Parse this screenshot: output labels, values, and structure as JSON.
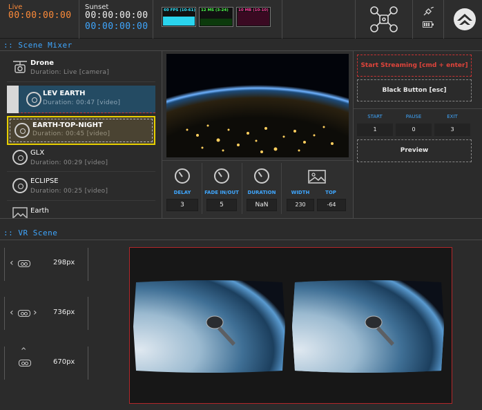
{
  "header": {
    "live_label": "Live",
    "live_time": "00:00:00:00",
    "sunset_label": "Sunset",
    "sunset_time_1": "00:00:00:00",
    "sunset_time_2": "00:00:00:00",
    "stats": [
      {
        "label": "60 FPS (10-61)",
        "color": "#33e6ff"
      },
      {
        "label": "12 MS (3-24)",
        "color": "#4dff4d"
      },
      {
        "label": "10 MB (10-10)",
        "color": "#ff3d9e"
      }
    ]
  },
  "scene_mixer": {
    "title": ":: Scene Mixer",
    "scenes": [
      {
        "name": "Drone",
        "duration": "Duration: Live [camera]",
        "icon": "camera-icon"
      },
      {
        "name": "LEV EARTH",
        "duration": "Duration: 00:47 [video]",
        "icon": "film-reel-icon"
      },
      {
        "name": "EARTH-TOP-NIGHT",
        "duration": "Duration: 00:45 [video]",
        "icon": "film-reel-icon"
      },
      {
        "name": "GLX",
        "duration": "Duration: 00:29 [video]",
        "icon": "film-reel-icon"
      },
      {
        "name": "ECLIPSE",
        "duration": "Duration: 00:25 [video]",
        "icon": "film-reel-icon"
      },
      {
        "name": "Earth",
        "duration": "",
        "icon": "image-icon"
      }
    ],
    "controls": {
      "delay_label": "DELAY",
      "delay_value": "3",
      "fade_label": "FADE IN/OUT",
      "fade_value": "5",
      "duration_label": "DURATION",
      "duration_value": "NaN",
      "width_label": "WIDTH",
      "width_value": "230",
      "top_label": "TOP",
      "top_value": "-64"
    }
  },
  "streaming": {
    "start_label": "Start Streaming [cmd + enter]",
    "black_label": "Black Button [esc]",
    "start_col": "START",
    "pause_col": "PAUSE",
    "exit_col": "EXIT",
    "start_val": "1",
    "pause_val": "0",
    "exit_val": "3",
    "preview_label": "Preview"
  },
  "vr_scene": {
    "title": ":: VR Scene",
    "rows": [
      {
        "value": "298px"
      },
      {
        "value": "736px"
      },
      {
        "value": "670px"
      }
    ]
  }
}
